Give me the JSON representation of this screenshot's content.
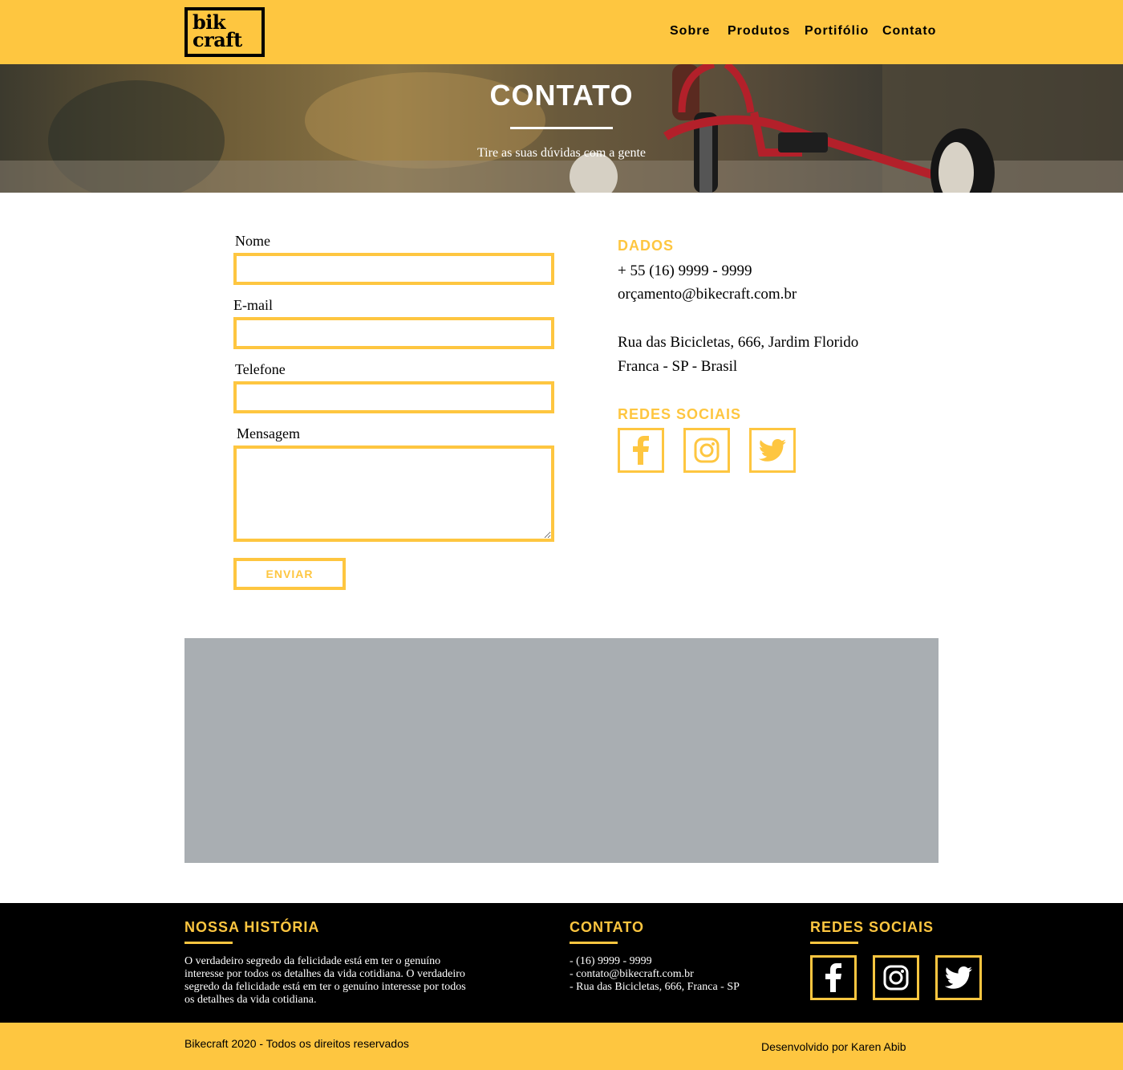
{
  "header": {
    "logo_line1": "bik",
    "logo_line2": "craft",
    "nav": [
      "Sobre",
      "Produtos",
      "Portifólio",
      "Contato"
    ]
  },
  "hero": {
    "title": "CONTATO",
    "subtitle": "Tire as suas dúvidas com a gente"
  },
  "form": {
    "name_label": "Nome",
    "email_label": "E-mail",
    "phone_label": "Telefone",
    "message_label": "Mensagem",
    "name_value": "",
    "email_value": "",
    "phone_value": "",
    "message_value": "",
    "submit_label": "ENVIAR"
  },
  "dados": {
    "title": "DADOS",
    "phone": "+ 55 (16) 9999 - 9999",
    "email": "orçamento@bikecraft.com.br",
    "address_line1": "Rua das Bicicletas, 666, Jardim Florido",
    "address_line2": "Franca - SP - Brasil",
    "social_title": "REDES SOCIAIS",
    "social_icons": [
      "facebook-icon",
      "instagram-icon",
      "twitter-icon"
    ]
  },
  "footer": {
    "history_title": "NOSSA HISTÓRIA",
    "history_lines": [
      "O verdadeiro segredo da felicidade está em ter o genuíno",
      "interesse por todos os detalhes da vida cotidiana. O verdadeiro",
      "segredo da felicidade está em ter o genuíno interesse por todos",
      "os detalhes da vida cotidiana."
    ],
    "contact_title": "CONTATO",
    "contact_lines": [
      "- (16) 9999 - 9999",
      "- contato@bikecraft.com.br",
      "- Rua das Bicicletas, 666, Franca - SP"
    ],
    "social_title": "REDES SOCIAIS",
    "copyright": "Bikecraft 2020 - Todos os direitos reservados",
    "credit": "Desenvolvido por Karen Abib"
  },
  "colors": {
    "accent": "#FEC640",
    "map": "#A9AEB2",
    "footer_bg": "#000000"
  }
}
